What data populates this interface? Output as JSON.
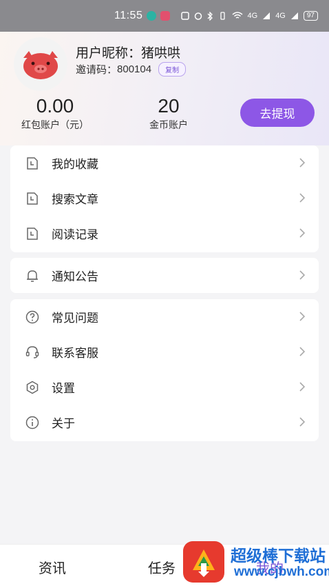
{
  "status_bar": {
    "time": "11:55",
    "signal1": "4G",
    "signal2": "4G",
    "battery": "97"
  },
  "profile": {
    "nickname_label": "用户昵称：",
    "nickname": "猪哄哄",
    "invite_label": "邀请码：",
    "invite_code": "800104",
    "copy_label": "复制"
  },
  "stats": {
    "red_packet_value": "0.00",
    "red_packet_label": "红包账户（元）",
    "coin_value": "20",
    "coin_label": "金币账户",
    "withdraw_label": "去提现"
  },
  "menu_group1": [
    {
      "label": "我的收藏",
      "icon": "document-icon"
    },
    {
      "label": "搜索文章",
      "icon": "document-icon"
    },
    {
      "label": "阅读记录",
      "icon": "document-icon"
    }
  ],
  "menu_group2": [
    {
      "label": "通知公告",
      "icon": "bell-icon"
    }
  ],
  "menu_group3": [
    {
      "label": "常见问题",
      "icon": "question-icon"
    },
    {
      "label": "联系客服",
      "icon": "headset-icon"
    },
    {
      "label": "设置",
      "icon": "settings-icon"
    },
    {
      "label": "关于",
      "icon": "info-icon"
    }
  ],
  "bottom_nav": {
    "news": "资讯",
    "tasks": "任务",
    "mine": "我的"
  },
  "watermark": {
    "title": "超级棒下载站",
    "url": "www.cjbwh.com"
  },
  "colors": {
    "accent": "#8d57e6",
    "watermark_blue": "#1f6fd6"
  }
}
